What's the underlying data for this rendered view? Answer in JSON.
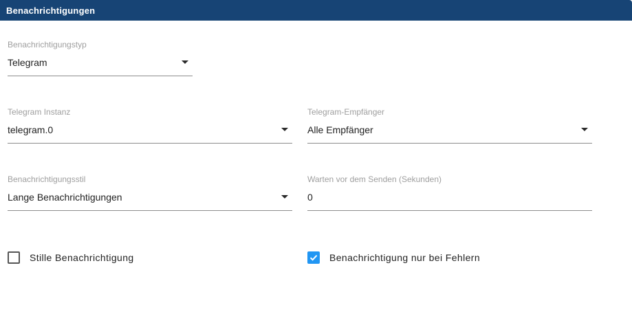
{
  "header": {
    "title": "Benachrichtigungen"
  },
  "fields": {
    "notification_type": {
      "label": "Benachrichtigungstyp",
      "value": "Telegram"
    },
    "telegram_instance": {
      "label": "Telegram Instanz",
      "value": "telegram.0"
    },
    "telegram_recipient": {
      "label": "Telegram-Empfänger",
      "value": "Alle Empfänger"
    },
    "notification_style": {
      "label": "Benachrichtigungsstil",
      "value": "Lange Benachrichtigungen"
    },
    "wait_before_send": {
      "label": "Warten vor dem Senden (Sekunden)",
      "value": "0"
    }
  },
  "checkboxes": {
    "silent": {
      "label": "Stille Benachrichtigung",
      "checked": false
    },
    "errors_only": {
      "label": "Benachrichtigung nur bei Fehlern",
      "checked": true
    }
  },
  "colors": {
    "header_bg": "#174475",
    "checkbox_checked": "#2196f3"
  },
  "icons": {
    "dropdown": "arrow-drop-down-icon",
    "check": "check-icon"
  }
}
